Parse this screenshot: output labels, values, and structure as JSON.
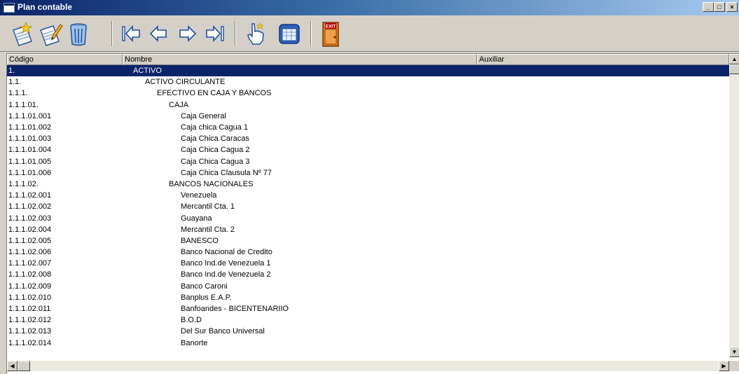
{
  "window": {
    "title": "Plan contable",
    "controls": {
      "minimize": "_",
      "maximize": "□",
      "close": "×"
    }
  },
  "toolbar": {
    "buttons": [
      {
        "name": "new-document-icon"
      },
      {
        "name": "edit-document-icon"
      },
      {
        "name": "trash-icon"
      },
      {
        "name": "first-record-icon"
      },
      {
        "name": "previous-record-icon"
      },
      {
        "name": "next-record-icon"
      },
      {
        "name": "last-record-icon"
      },
      {
        "name": "pointer-hand-icon"
      },
      {
        "name": "calendar-window-icon"
      },
      {
        "name": "exit-door-icon",
        "label": "EXIT"
      }
    ]
  },
  "grid": {
    "columns": [
      "Código",
      "Nombre",
      "Auxiliar"
    ],
    "selected_index": 0,
    "rows": [
      {
        "code": "1.",
        "name": "ACTIVO",
        "level": 1,
        "aux": ""
      },
      {
        "code": "1.1.",
        "name": "ACTIVO CIRCULANTE",
        "level": 2,
        "aux": ""
      },
      {
        "code": "1.1.1.",
        "name": "EFECTIVO EN CAJA Y BANCOS",
        "level": 3,
        "aux": ""
      },
      {
        "code": "1.1.1.01.",
        "name": "CAJA",
        "level": 4,
        "aux": ""
      },
      {
        "code": "1.1.1.01.001",
        "name": "Caja General",
        "level": 5,
        "aux": ""
      },
      {
        "code": "1.1.1.01.002",
        "name": "Caja chica Cagua 1",
        "level": 5,
        "aux": ""
      },
      {
        "code": "1.1.1.01.003",
        "name": "Caja Chica Caracas",
        "level": 5,
        "aux": ""
      },
      {
        "code": "1.1.1.01.004",
        "name": "Caja Chica Cagua 2",
        "level": 5,
        "aux": ""
      },
      {
        "code": "1.1.1.01.005",
        "name": "Caja Chica Cagua 3",
        "level": 5,
        "aux": ""
      },
      {
        "code": "1.1.1.01.006",
        "name": "Caja Chica Clausula Nº 77",
        "level": 5,
        "aux": ""
      },
      {
        "code": "1.1.1.02.",
        "name": "BANCOS NACIONALES",
        "level": 4,
        "aux": ""
      },
      {
        "code": "1.1.1.02.001",
        "name": "Venezuela",
        "level": 5,
        "aux": ""
      },
      {
        "code": "1.1.1.02.002",
        "name": "Mercantil Cta. 1",
        "level": 5,
        "aux": ""
      },
      {
        "code": "1.1.1.02.003",
        "name": "Guayana",
        "level": 5,
        "aux": ""
      },
      {
        "code": "1.1.1.02.004",
        "name": "Mercantil Cta. 2",
        "level": 5,
        "aux": ""
      },
      {
        "code": "1.1.1.02.005",
        "name": "BANESCO",
        "level": 5,
        "aux": ""
      },
      {
        "code": "1.1.1.02.006",
        "name": "Banco Nacional de Credito",
        "level": 5,
        "aux": ""
      },
      {
        "code": "1.1.1.02.007",
        "name": "Banco Ind.de Venezuela 1",
        "level": 5,
        "aux": ""
      },
      {
        "code": "1.1.1.02.008",
        "name": "Banco Ind.de Venezuela 2",
        "level": 5,
        "aux": ""
      },
      {
        "code": "1.1.1.02.009",
        "name": "Banco Caroni",
        "level": 5,
        "aux": ""
      },
      {
        "code": "1.1.1.02.010",
        "name": "Banplus E.A.P.",
        "level": 5,
        "aux": ""
      },
      {
        "code": "1.1.1.02.011",
        "name": "Banfoandes - BICENTENARIIO",
        "level": 5,
        "aux": ""
      },
      {
        "code": "1.1.1.02.012",
        "name": "B.O.D",
        "level": 5,
        "aux": ""
      },
      {
        "code": "1.1.1.02.013",
        "name": "Del Sur Banco Universal",
        "level": 5,
        "aux": ""
      },
      {
        "code": "1.1.1.02.014",
        "name": "Banorte",
        "level": 5,
        "aux": ""
      }
    ]
  },
  "colors": {
    "selection": "#0a246a",
    "titlebar_start": "#0a246a",
    "titlebar_end": "#a6caf0"
  }
}
